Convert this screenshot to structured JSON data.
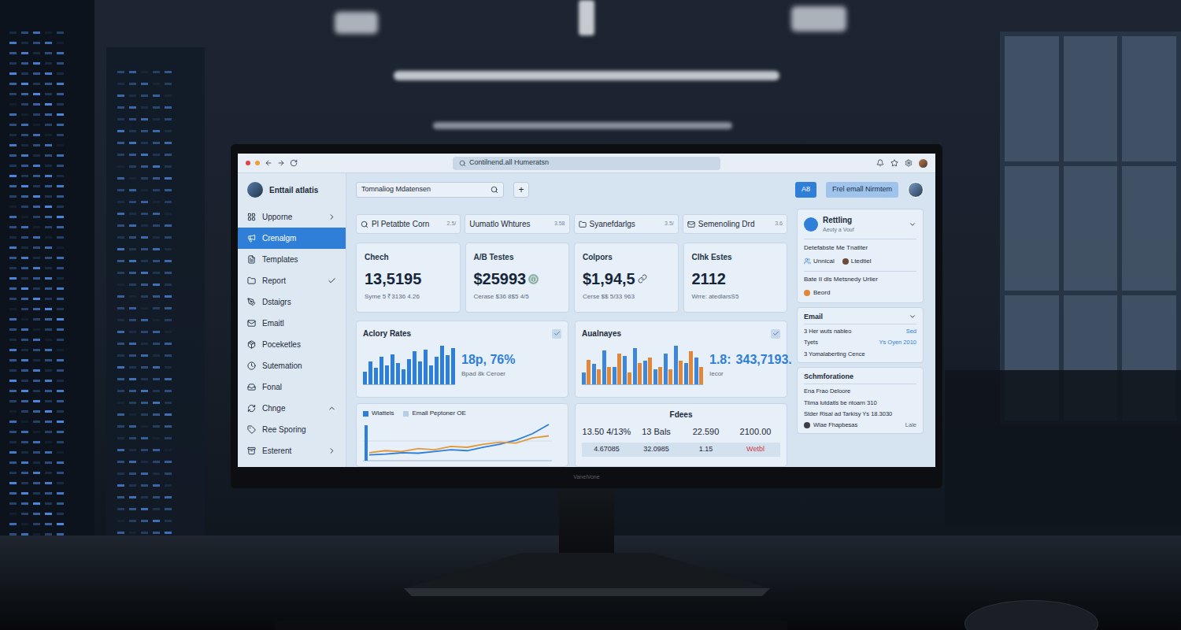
{
  "browser": {
    "address": "Contilnend.all Humeratsn"
  },
  "monitor": {
    "brand": "VanelVone"
  },
  "sidebar": {
    "title": "Enttail atlatis",
    "items": [
      {
        "label": "Upporne",
        "selected": false,
        "trail": "chevron-right"
      },
      {
        "label": "Crenalgm",
        "selected": true,
        "trail": "none"
      },
      {
        "label": "Templates",
        "selected": false,
        "trail": "none"
      },
      {
        "label": "Report",
        "selected": false,
        "trail": "check"
      },
      {
        "label": "Dstaigrs",
        "selected": false,
        "trail": "none"
      },
      {
        "label": "Emaitl",
        "selected": false,
        "trail": "none"
      },
      {
        "label": "Poceketles",
        "selected": false,
        "trail": "none"
      },
      {
        "label": "Sutemation",
        "selected": false,
        "trail": "none"
      },
      {
        "label": "Fonal",
        "selected": false,
        "trail": "none"
      },
      {
        "label": "Chnge",
        "selected": false,
        "trail": "chevron-up"
      },
      {
        "label": "Ree Sporing",
        "selected": false,
        "trail": "none"
      },
      {
        "label": "Esterent",
        "selected": false,
        "trail": "chevron-right"
      }
    ]
  },
  "toolbar": {
    "search": "Tomnaliog Mdatensen",
    "add": "+",
    "buttons": [
      {
        "label": "A8",
        "primary": true
      },
      {
        "label": "Frel emall Nirmtem",
        "primary": false
      }
    ]
  },
  "tabs": [
    {
      "label": "Pl Petatbte Corn",
      "badge": "2.5/",
      "selected": false
    },
    {
      "label": "Uumatlo Whtures",
      "badge": "3.58",
      "selected": false
    },
    {
      "label": "Syanefdarlgs",
      "badge": "3.5/",
      "selected": false
    },
    {
      "label": "Semenoling Drd",
      "badge": "3.6",
      "selected": false
    }
  ],
  "stats": [
    {
      "title": "Chech",
      "value": "13,5195",
      "sub": "Syme 5 ₹3136 4.26",
      "kind": "none"
    },
    {
      "title": "A/B Testes",
      "value": "$25993",
      "sub": "Cerase $36 8$5 4/5",
      "kind": "info"
    },
    {
      "title": "Colpors",
      "value": "$1,94,5",
      "sub": "Cerse $$ 5/33 963",
      "kind": "link"
    },
    {
      "title": "Clhk Estes",
      "value": "2112",
      "sub": "Wrre: atedlarsS5",
      "kind": "none"
    }
  ],
  "bar_charts": [
    {
      "title": "Aclory Rates",
      "figures": [
        "18p, 76%"
      ],
      "caption": "Bpad 8k Ceroer",
      "series": [
        {
          "color": "#2e7fd9",
          "values": [
            30,
            55,
            40,
            65,
            45,
            72,
            50,
            35,
            60,
            78,
            55,
            82,
            45,
            66,
            92,
            70,
            86
          ]
        }
      ]
    },
    {
      "title": "Aualnayes",
      "figures": [
        "1.8:",
        "343,7193."
      ],
      "caption": "Iecor",
      "series": [
        {
          "color": "#3d86d8",
          "values": [
            20,
            35,
            58,
            30,
            48,
            62,
            40,
            25,
            52,
            66,
            36,
            46
          ]
        },
        {
          "color": "#e0873a",
          "values": [
            42,
            25,
            30,
            52,
            20,
            36,
            46,
            30,
            25,
            40,
            56,
            30
          ]
        }
      ]
    }
  ],
  "line_chart": {
    "legend": [
      {
        "label": "Wlattels",
        "color": "#2e7fd9"
      },
      {
        "label": "Emall Peptoner OE",
        "color": "#b7cde6"
      }
    ],
    "series": [
      {
        "color": "#2e7fd9",
        "values": [
          10,
          12,
          15,
          14,
          18,
          22,
          20,
          28,
          35,
          45,
          60,
          82
        ]
      },
      {
        "color": "#e09a3c",
        "values": [
          15,
          20,
          18,
          25,
          22,
          30,
          28,
          35,
          40,
          38,
          50,
          55
        ]
      }
    ]
  },
  "table": {
    "title": "Fdees",
    "rows": [
      {
        "highlight": false,
        "cells": [
          {
            "text": "13.50 4/13%",
            "alert": false
          },
          {
            "text": "13 Bals",
            "alert": false
          },
          {
            "text": "22.590",
            "alert": false
          },
          {
            "text": "2100.00",
            "alert": false
          }
        ]
      },
      {
        "highlight": true,
        "cells": [
          {
            "text": "4.67085",
            "alert": false
          },
          {
            "text": "32.0985",
            "alert": false
          },
          {
            "text": "1.15",
            "alert": false
          },
          {
            "text": "Wetbl",
            "alert": true
          }
        ]
      }
    ]
  },
  "profile": {
    "name": "Rettling",
    "subtitle": "Aeuty a Vouf",
    "line": "Detefabste Me Tnatiter",
    "tags": [
      "Unnical",
      "Ltedtiel"
    ],
    "note": "Bate II dls Metsnedy Urlier",
    "footer": "Beord"
  },
  "email_panel": {
    "title": "Email",
    "rows": [
      {
        "label": "3 Her wuts nableo",
        "value": "Sed"
      },
      {
        "label": "Tyets",
        "value": "Ys Oyen 2010"
      },
      {
        "label": "3 Yomalaberting Cence"
      }
    ]
  },
  "schedule": {
    "title": "Schmforatione",
    "rows": [
      {
        "label": "Ena Frao Deloore",
        "avatar": false
      },
      {
        "label": "Tlima lutdatls be ntoarn 310",
        "avatar": false
      },
      {
        "label": "Stder Risal ad Tarkisy Ys 18.3030",
        "avatar": false
      },
      {
        "label": "Wlae Fhapbesas",
        "value": "Lale",
        "avatar": true
      }
    ]
  }
}
